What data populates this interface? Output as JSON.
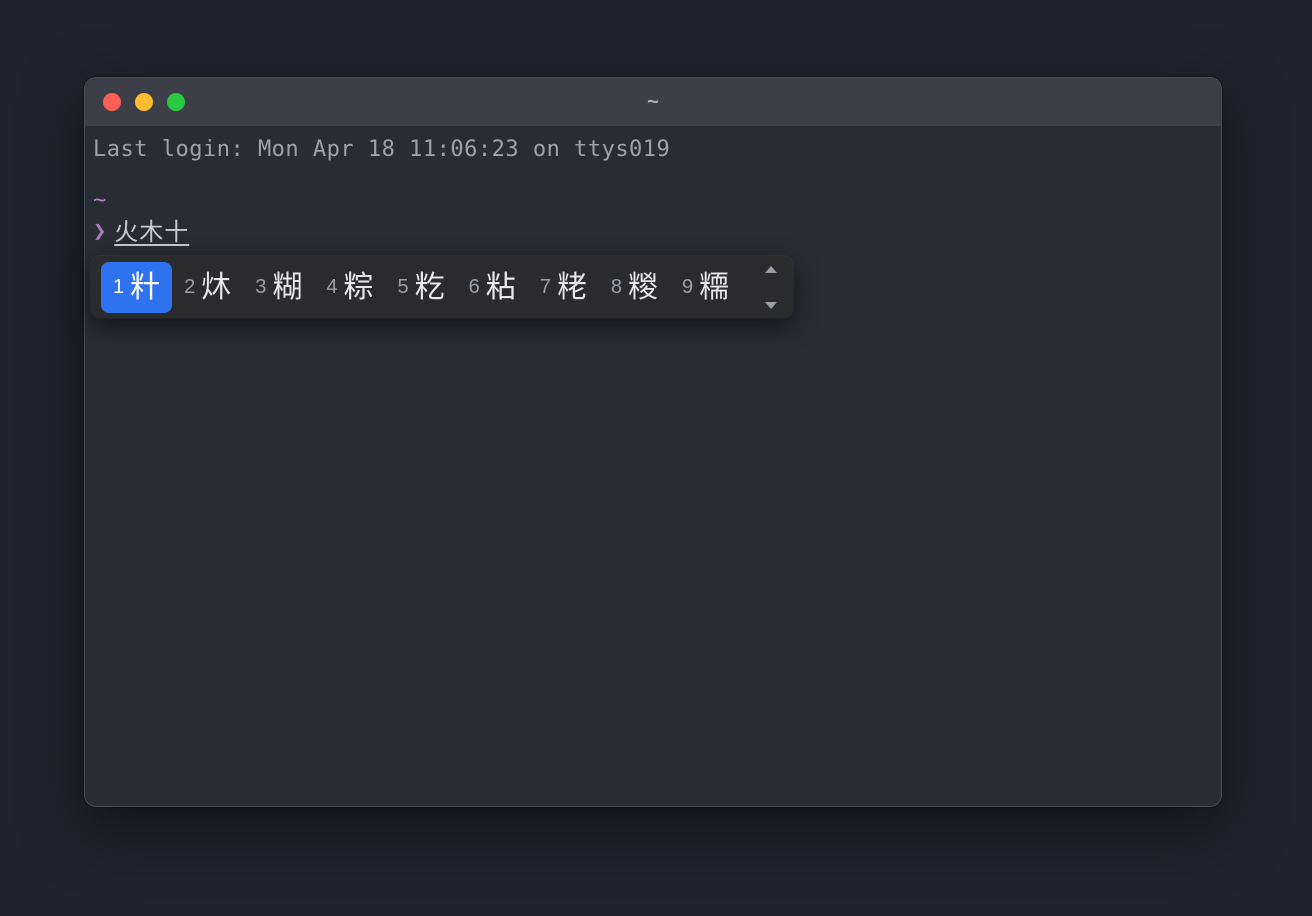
{
  "window": {
    "title": "~"
  },
  "terminal": {
    "login_line": "Last login: Mon Apr 18 11:06:23 on ttys019",
    "cwd": "~",
    "prompt_symbol": "❯",
    "ime_composition": "火木十"
  },
  "ime": {
    "candidates": [
      {
        "index": "1",
        "char": "籵"
      },
      {
        "index": "2",
        "char": "炑"
      },
      {
        "index": "3",
        "char": "糊"
      },
      {
        "index": "4",
        "char": "粽"
      },
      {
        "index": "5",
        "char": "籺"
      },
      {
        "index": "6",
        "char": "粘"
      },
      {
        "index": "7",
        "char": "粩"
      },
      {
        "index": "8",
        "char": "糉"
      },
      {
        "index": "9",
        "char": "糥"
      }
    ],
    "selected_index": 0
  }
}
